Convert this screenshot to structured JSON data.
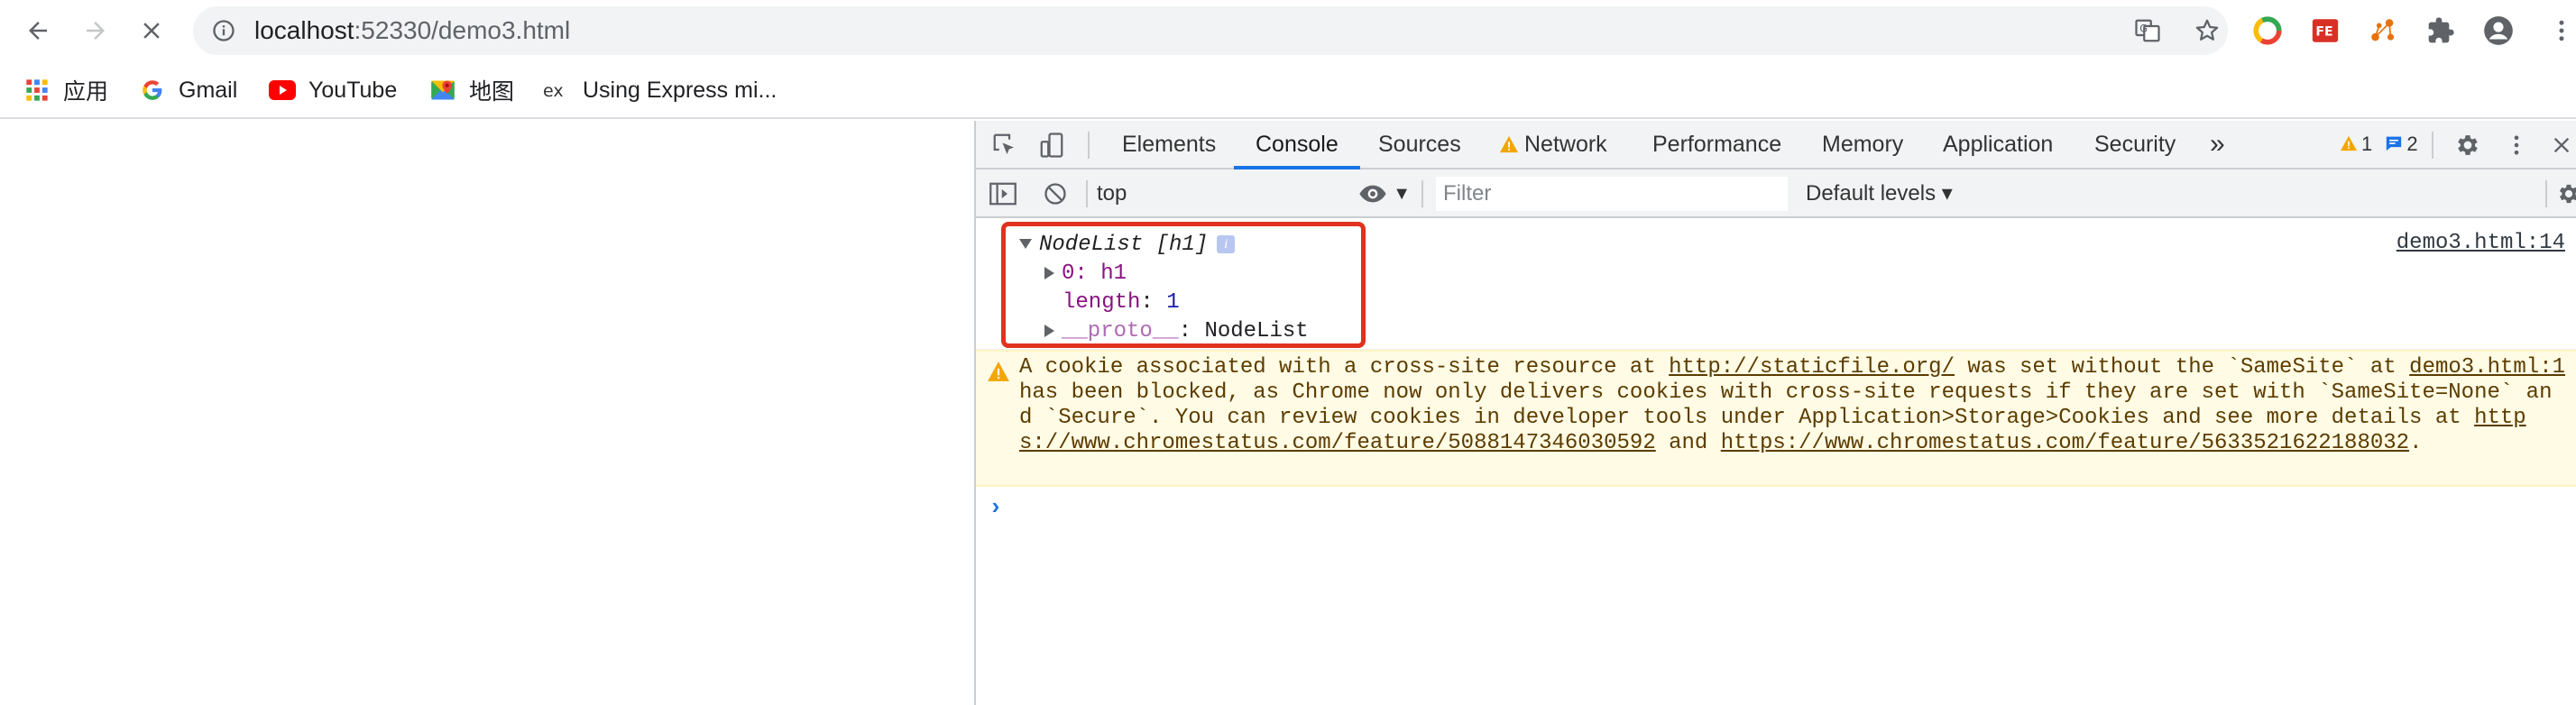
{
  "browser": {
    "url_host": "localhost",
    "url_path": ":52330/demo3.html"
  },
  "bookmarks": [
    {
      "label": "应用",
      "icon": "apps-grid-icon"
    },
    {
      "label": "Gmail",
      "icon": "google-g-icon"
    },
    {
      "label": "YouTube",
      "icon": "youtube-icon"
    },
    {
      "label": "地图",
      "icon": "maps-pin-icon"
    },
    {
      "label": "Using Express mi...",
      "icon": "express-ex-icon"
    }
  ],
  "devtools": {
    "tabs": [
      {
        "label": "Elements"
      },
      {
        "label": "Console",
        "active": true
      },
      {
        "label": "Sources"
      },
      {
        "label": "Network",
        "warning": true
      },
      {
        "label": "Performance"
      },
      {
        "label": "Memory"
      },
      {
        "label": "Application"
      },
      {
        "label": "Security"
      }
    ],
    "more_tabs": "»",
    "warning_count": "1",
    "message_count": "2",
    "context": "top",
    "filter_placeholder": "Filter",
    "levels_label": "Default levels ▾"
  },
  "console": {
    "log": {
      "header": "NodeList [h1]",
      "info": "i",
      "entry_key": "0",
      "entry_value": "h1",
      "length_key": "length",
      "length_value": "1",
      "proto_key": "__proto__",
      "proto_value": "NodeList",
      "source": "demo3.html:14"
    },
    "warning": {
      "text_1": "A cookie associated with a cross-site resource at ",
      "link_1": "http://staticfile.org/",
      "text_2": " was set without the `SameSite` attribute. It has been blocked, as Chrome now only delivers cookies with cross-site requests if they are set with `SameSite=None` and `Secure`. You can review cookies in developer tools under Application>Storage>Cookies and see more details at ",
      "link_2": "https://www.chromestatus.com/feature/5088147346030592",
      "text_3": " and ",
      "link_3": "https://www.chromestatus.com/feature/5633521622188032",
      "text_4": ".",
      "source": "demo3.html:1"
    },
    "prompt": "›"
  }
}
